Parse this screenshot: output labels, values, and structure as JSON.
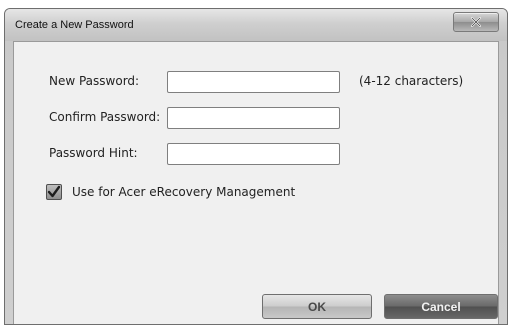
{
  "window": {
    "title": "Create a New Password",
    "close_glyph": "X"
  },
  "form": {
    "new_password_label": "New Password:",
    "new_password_value": "",
    "new_password_hint": "(4-12 characters)",
    "confirm_password_label": "Confirm Password:",
    "confirm_password_value": "",
    "password_hint_label": "Password Hint:",
    "password_hint_value": "",
    "checkbox_label": "Use for Acer eRecovery Management",
    "checkbox_checked": true
  },
  "buttons": {
    "ok_label": "OK",
    "cancel_label": "Cancel"
  },
  "icons": {
    "close": "close-icon",
    "checkmark": "checkmark-icon"
  }
}
